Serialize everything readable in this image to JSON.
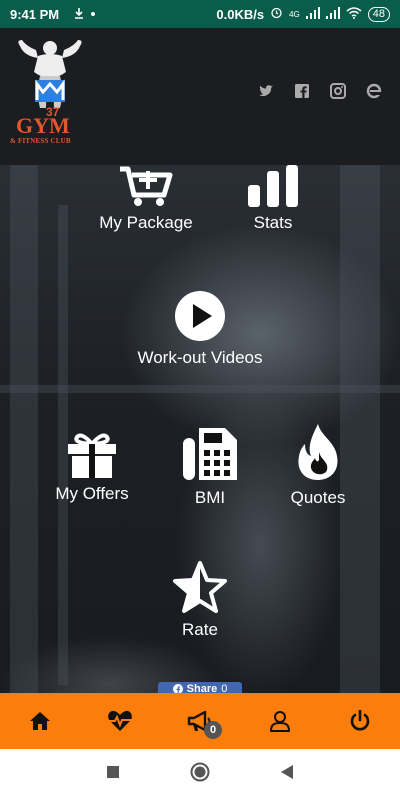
{
  "status_bar": {
    "time": "9:41 PM",
    "network_speed": "0.0KB/s",
    "network_type": "4G",
    "battery": "48"
  },
  "brand": {
    "logo_letters": "M",
    "logo_number": "37",
    "name": "GYM",
    "subtitle": "& FITNESS CLUB",
    "accent_color": "#e2572b"
  },
  "social_icons": [
    "twitter-icon",
    "facebook-icon",
    "instagram-icon",
    "internet-explorer-icon"
  ],
  "menu": {
    "my_package": "My Package",
    "stats": "Stats",
    "workout_videos": "Work-out Videos",
    "my_offers": "My Offers",
    "bmi": "BMI",
    "quotes": "Quotes",
    "rate": "Rate"
  },
  "share": {
    "label": "Share",
    "count": "0"
  },
  "bottom_nav": {
    "color": "#fb7d0b",
    "items": [
      "home-icon",
      "heartbeat-icon",
      "megaphone-icon",
      "user-icon",
      "power-icon"
    ],
    "notifications_badge": "0"
  }
}
